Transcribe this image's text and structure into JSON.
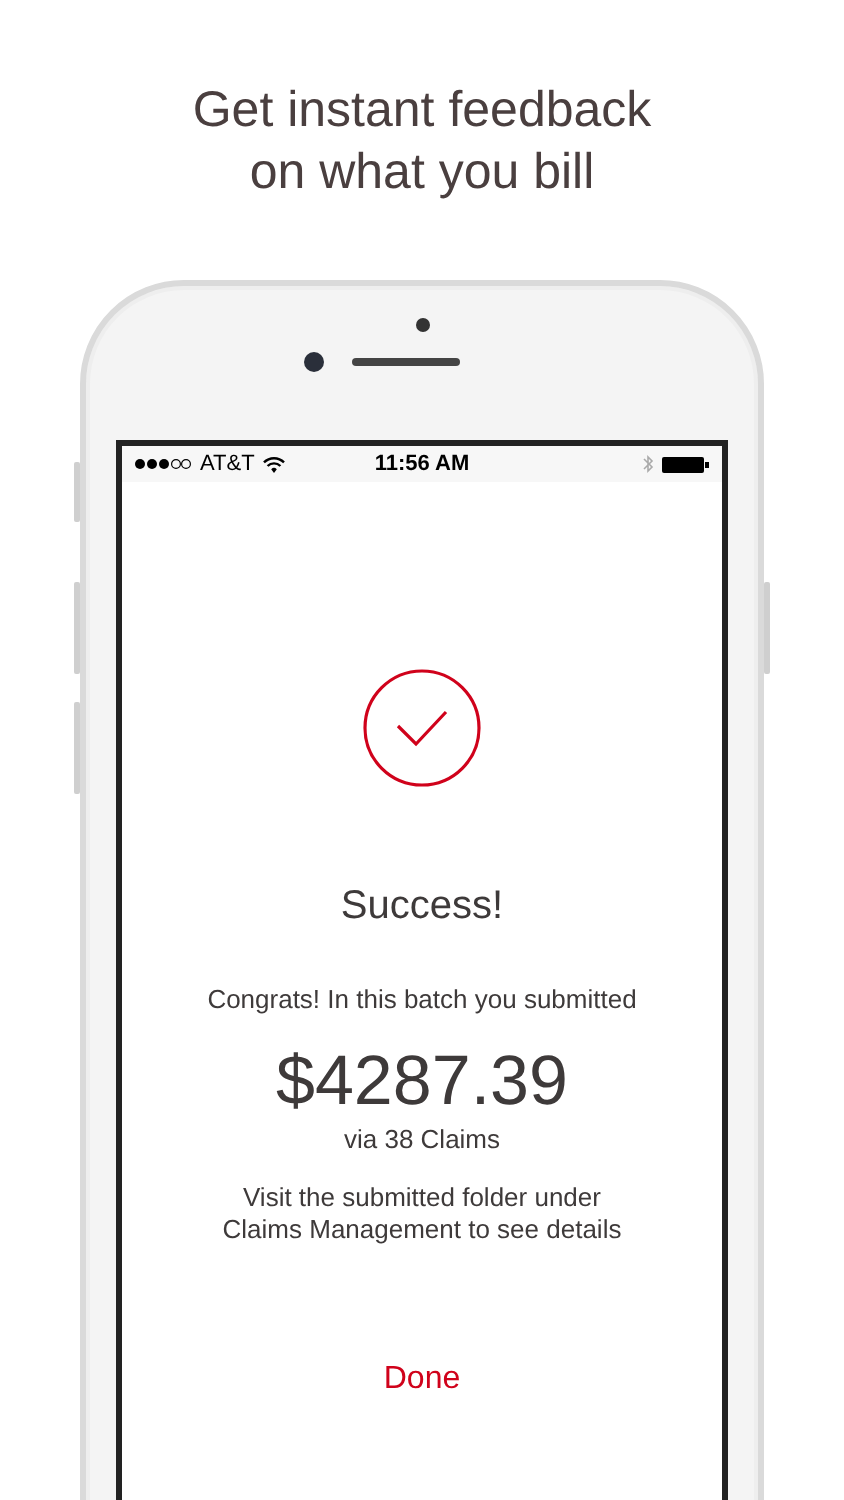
{
  "headline": [
    "Get instant feedback",
    "on what you bill"
  ],
  "status_bar": {
    "carrier": "AT&T",
    "time": "11:56 AM"
  },
  "screen": {
    "title": "Success!",
    "message": "Congrats! In this batch you submitted",
    "amount": "$4287.39",
    "claims": "via 38 Claims",
    "note": [
      "Visit the submitted folder under",
      "Claims Management to see details"
    ],
    "done": "Done"
  }
}
